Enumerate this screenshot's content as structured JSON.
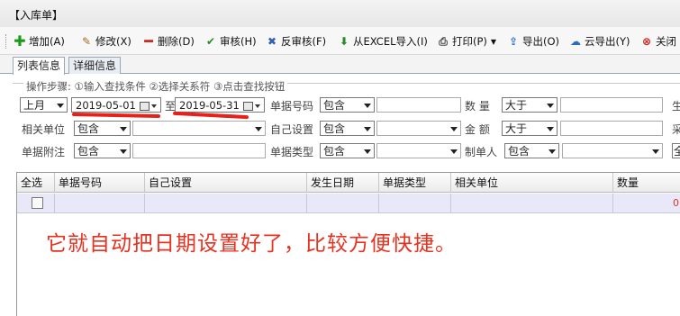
{
  "window": {
    "title": "【入库单】"
  },
  "toolbar": {
    "buttons": [
      {
        "label": "增加(A)",
        "icon": "plus-icon",
        "color": "#1a9a1a"
      },
      {
        "label": "修改(X)",
        "icon": "edit-document-icon",
        "color": "#a36a1e"
      },
      {
        "label": "删除(D)",
        "icon": "minus-icon",
        "color": "#d0201a"
      },
      {
        "label": "审核(H)",
        "icon": "checkmark-icon",
        "color": "#2a8a2a"
      },
      {
        "label": "反审核(F)",
        "icon": "cross-icon",
        "color": "#3060b0"
      },
      {
        "label": "从EXCEL导入(I)",
        "icon": "download-arrow-icon",
        "color": "#2a8a2a"
      },
      {
        "label": "打印(P)",
        "icon": "printer-icon",
        "color": "#444444"
      },
      {
        "label": "导出(O)",
        "icon": "export-icon",
        "color": "#2a6cc0"
      },
      {
        "label": "云导出(Y)",
        "icon": "cloud-icon",
        "color": "#2a6cc0"
      },
      {
        "label": "关闭",
        "icon": "close-circle-icon",
        "color": "#d0201a"
      }
    ]
  },
  "tabs": [
    {
      "label": "列表信息",
      "active": true
    },
    {
      "label": "详细信息",
      "active": false
    }
  ],
  "search": {
    "steps": "操作步骤:   ①输入查找条件  ②选择关系符  ③点击查找按钮",
    "period_select": "上月",
    "date_from": "2019-05-01",
    "date_to_label": "至",
    "date_to": "2019-05-31",
    "doc_no_label": "单据号码",
    "doc_no_op": "包含",
    "qty_label": "数  量",
    "qty_op": "大于",
    "related_unit_label": "相关单位",
    "related_unit_op": "包含",
    "self_setting_label": "自己设置",
    "self_setting_op": "包含",
    "amount_label": "金  额",
    "amount_op": "大于",
    "remark_label": "单据附注",
    "remark_op": "包含",
    "doc_type_label": "单据类型",
    "doc_type_op": "包含",
    "maker_label": "制单人",
    "maker_op": "包含",
    "cut_label_1": "生",
    "cut_label_2": "采",
    "cut_label_3": "全"
  },
  "grid": {
    "columns": [
      "全选",
      "单据号码",
      "自己设置",
      "发生日期",
      "单据类型",
      "相关单位",
      "数量"
    ],
    "row_value": "0"
  },
  "annotation": {
    "text": "它就自动把日期设置好了，比较方便快捷。",
    "color": "#e8311f"
  }
}
